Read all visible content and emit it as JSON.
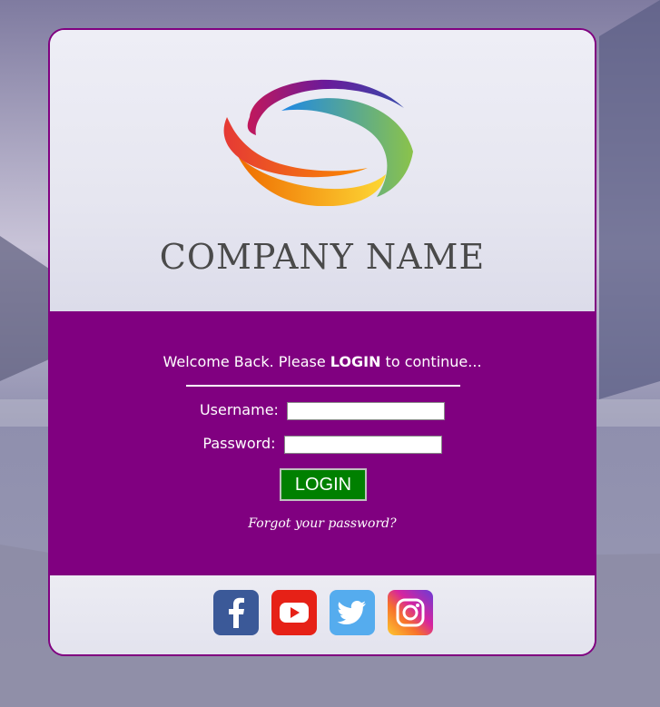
{
  "brand": {
    "company_name": "COMPANY NAME",
    "logo_icon": "swirl-ring-logo-icon"
  },
  "login": {
    "welcome_prefix": "Welcome Back. Please ",
    "welcome_emphasis": "LOGIN",
    "welcome_suffix": " to continue...",
    "username_label": "Username:",
    "username_value": "",
    "password_label": "Password:",
    "password_value": "",
    "submit_label": "LOGIN",
    "forgot_label": "Forgot your password?"
  },
  "social": [
    {
      "name": "facebook-icon",
      "color": "#3b5998"
    },
    {
      "name": "youtube-icon",
      "color": "#e62117"
    },
    {
      "name": "twitter-icon",
      "color": "#55acee"
    },
    {
      "name": "instagram-icon",
      "color": "#d6249f"
    }
  ],
  "colors": {
    "panel": "#800080",
    "button": "#008000",
    "border": "#800080"
  }
}
